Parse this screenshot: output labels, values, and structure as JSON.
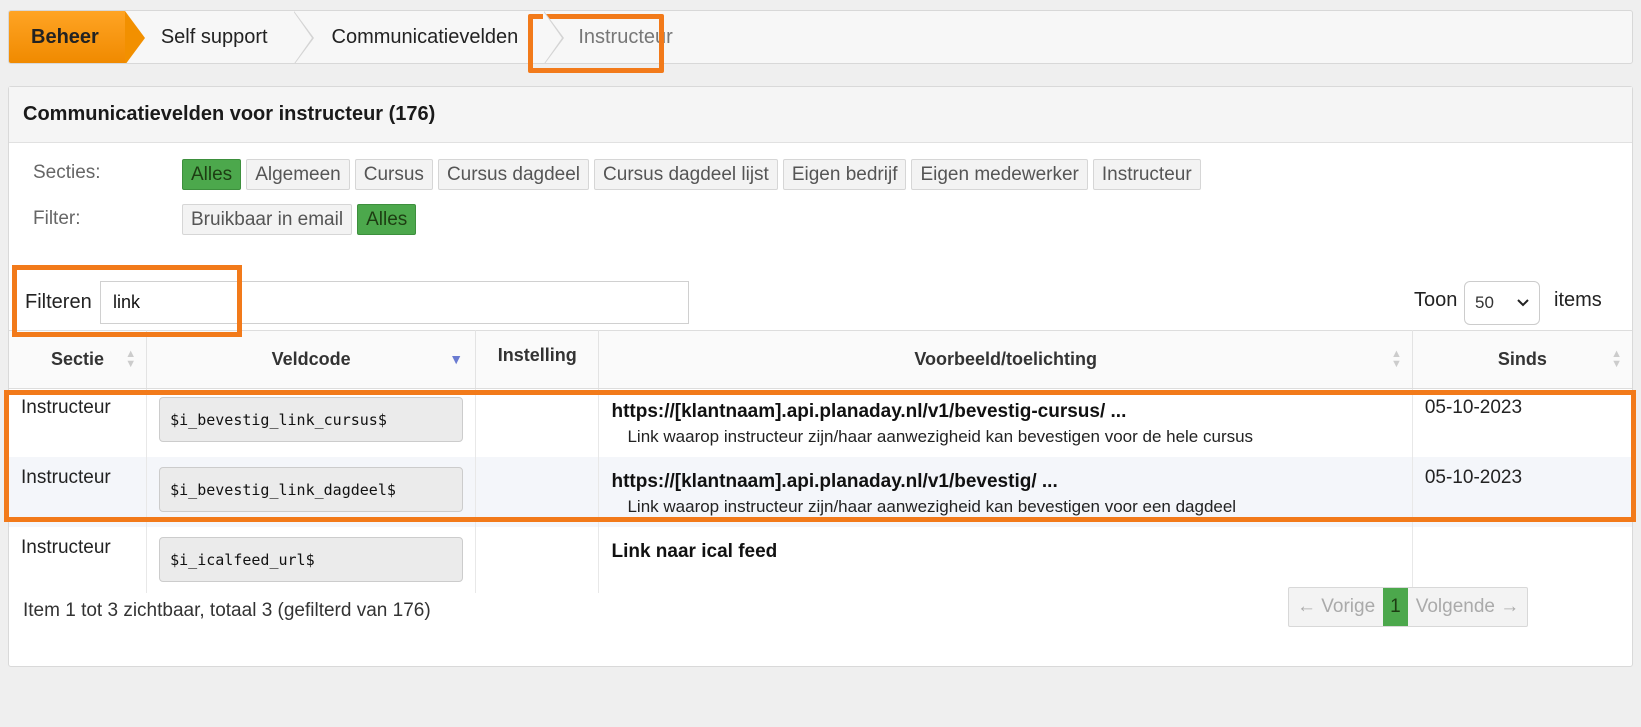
{
  "breadcrumb": {
    "items": [
      {
        "label": "Beheer"
      },
      {
        "label": "Self support"
      },
      {
        "label": "Communicatievelden"
      },
      {
        "label": "Instructeur"
      }
    ]
  },
  "panel": {
    "title": "Communicatievelden voor instructeur (176)",
    "secties": {
      "label": "Secties:",
      "options": [
        "Alles",
        "Algemeen",
        "Cursus",
        "Cursus dagdeel",
        "Cursus dagdeel lijst",
        "Eigen bedrijf",
        "Eigen medewerker",
        "Instructeur"
      ],
      "active": "Alles"
    },
    "filter": {
      "label": "Filter:",
      "options": [
        "Bruikbaar in email",
        "Alles"
      ],
      "active": "Alles"
    },
    "search": {
      "label": "Filteren",
      "value": "link"
    },
    "page_size": {
      "prefix": "Toon",
      "value": "50",
      "suffix": "items"
    },
    "table": {
      "columns": [
        "Sectie",
        "Veldcode",
        "Instelling",
        "Voorbeeld/toelichting",
        "Sinds"
      ],
      "rows": [
        {
          "sectie": "Instructeur",
          "veldcode": "$i_bevestig_link_cursus$",
          "instelling": "",
          "voorbeeld": "https://[klantnaam].api.planaday.nl/v1/bevestig-cursus/ ...",
          "toelichting": "Link waarop instructeur zijn/haar aanwezigheid kan bevestigen voor de hele cursus",
          "sinds": "05-10-2023"
        },
        {
          "sectie": "Instructeur",
          "veldcode": "$i_bevestig_link_dagdeel$",
          "instelling": "",
          "voorbeeld": "https://[klantnaam].api.planaday.nl/v1/bevestig/ ...",
          "toelichting": "Link waarop instructeur zijn/haar aanwezigheid kan bevestigen voor een dagdeel",
          "sinds": "05-10-2023"
        },
        {
          "sectie": "Instructeur",
          "veldcode": "$i_icalfeed_url$",
          "instelling": "",
          "voorbeeld": "Link naar ical feed",
          "toelichting": "",
          "sinds": ""
        }
      ]
    },
    "footer": {
      "summary": "Item 1 tot 3 zichtbaar, totaal 3 (gefilterd van 176)",
      "prev": "← Vorige",
      "page": "1",
      "next": "Volgende →"
    }
  },
  "colors": {
    "accent_orange": "#f08a00",
    "highlight": "#f27a1a",
    "active_green": "#4ca84c"
  }
}
